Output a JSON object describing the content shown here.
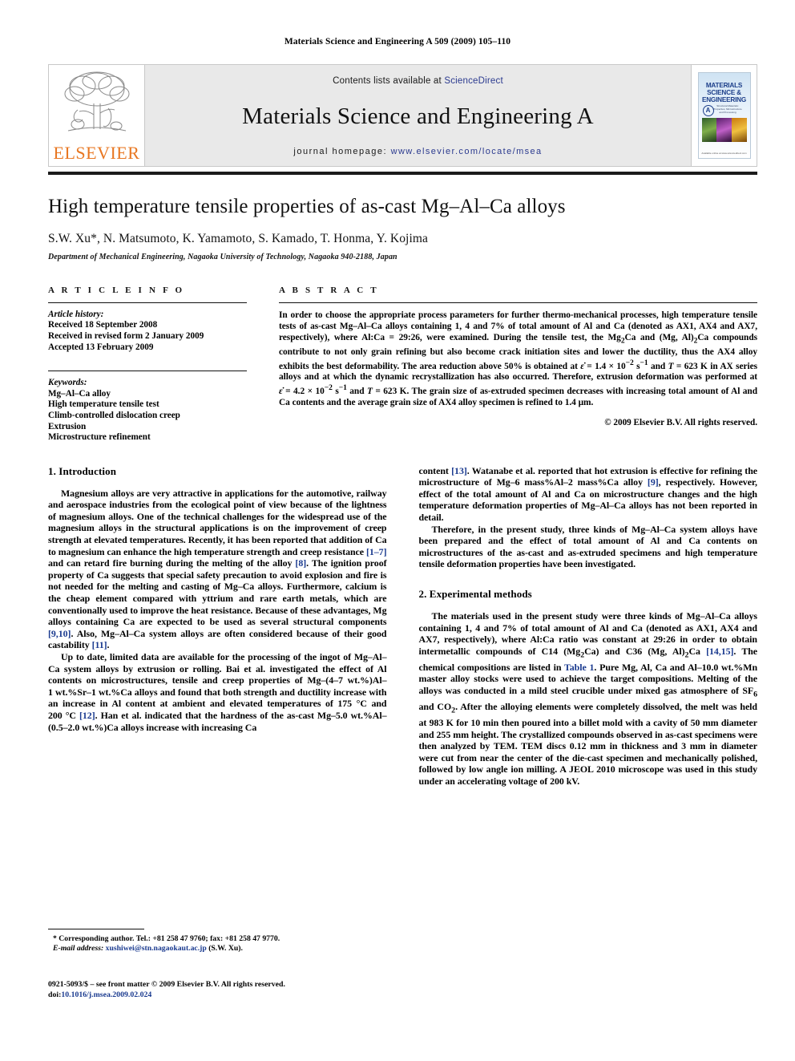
{
  "running_head": "Materials Science and Engineering A 509 (2009) 105–110",
  "masthead": {
    "publisher_name": "ELSEVIER",
    "contents_prefix": "Contents lists available at ",
    "contents_link": "ScienceDirect",
    "journal_title": "Materials Science and Engineering A",
    "homepage_prefix": "journal homepage: ",
    "homepage_url": "www.elsevier.com/locate/msea",
    "cover": {
      "line1": "MATERIALS",
      "line2": "SCIENCE &",
      "line3": "ENGINEERING",
      "badge": "A",
      "subtitle": "Structural Materials: Properties, Microstructure and Processing",
      "footer": "Available online at www.sciencedirect.com"
    },
    "link_color": "#2b3a8f",
    "brand_color": "#e87722"
  },
  "article": {
    "title": "High temperature tensile properties of as-cast Mg–Al–Ca alloys",
    "authors": "S.W. Xu*, N. Matsumoto, K. Yamamoto, S. Kamado, T. Honma, Y. Kojima",
    "affiliation": "Department of Mechanical Engineering, Nagaoka University of Technology, Nagaoka 940-2188, Japan"
  },
  "article_info": {
    "heading": "A R T I C L E   I N F O",
    "history_label": "Article history:",
    "history": [
      "Received 18 September 2008",
      "Received in revised form 2 January 2009",
      "Accepted 13 February 2009"
    ],
    "keywords_label": "Keywords:",
    "keywords": [
      "Mg–Al–Ca alloy",
      "High temperature tensile test",
      "Climb-controlled dislocation creep",
      "Extrusion",
      "Microstructure refinement"
    ]
  },
  "abstract": {
    "heading": "A B S T R A C T",
    "text": "In order to choose the appropriate process parameters for further thermo-mechanical processes, high temperature tensile tests of as-cast Mg–Al–Ca alloys containing 1, 4 and 7% of total amount of Al and Ca (denoted as AX1, AX4 and AX7, respectively), where Al:Ca = 29:26, were examined. During the tensile test, the Mg2Ca and (Mg, Al)2Ca compounds contribute to not only grain refining but also become crack initiation sites and lower the ductility, thus the AX4 alloy exhibits the best deformability. The area reduction above 50% is obtained at ε̇ = 1.4 × 10−2 s−1 and T = 623 K in AX series alloys and at which the dynamic recrystallization has also occurred. Therefore, extrusion deformation was performed at ε̇ = 4.2 × 10−2 s−1 and T = 623 K. The grain size of as-extruded specimen decreases with increasing total amount of Al and Ca contents and the average grain size of AX4 alloy specimen is refined to 1.4 μm.",
    "copyright": "© 2009 Elsevier B.V. All rights reserved."
  },
  "sections": {
    "introduction_heading": "1.  Introduction",
    "experimental_heading": "2.  Experimental methods",
    "intro_p1": "Magnesium alloys are very attractive in applications for the automotive, railway and aerospace industries from the ecological point of view because of the lightness of magnesium alloys. One of the technical challenges for the widespread use of the magnesium alloys in the structural applications is on the improvement of creep strength at elevated temperatures. Recently, it has been reported that addition of Ca to magnesium can enhance the high temperature strength and creep resistance [1–7] and can retard fire burning during the melting of the alloy [8]. The ignition proof property of Ca suggests that special safety precaution to avoid explosion and fire is not needed for the melting and casting of Mg–Ca alloys. Furthermore, calcium is the cheap element compared with yttrium and rare earth metals, which are conventionally used to improve the heat resistance. Because of these advantages, Mg alloys containing Ca are expected to be used as several structural components [9,10]. Also, Mg–Al–Ca system alloys are often considered because of their good castability [11].",
    "intro_p2": "Up to date, limited data are available for the processing of the ingot of Mg–Al–Ca system alloys by extrusion or rolling. Bai et al. investigated the effect of Al contents on microstructures, tensile and creep properties of Mg–(4–7 wt.%)Al–1 wt.%Sr–1 wt.%Ca alloys and found that both strength and ductility increase with an increase in Al content at ambient and elevated temperatures of 175 °C and 200 °C [12]. Han et al. indicated that the hardness of the as-cast Mg–5.0 wt.%Al–(0.5–2.0 wt.%)Ca alloys increase with increasing Ca content [13]. Watanabe et al. reported that hot extrusion is effective for refining the microstructure of Mg–6 mass%Al–2 mass%Ca alloy [9], respectively. However, effect of the total amount of Al and Ca on microstructure changes and the high temperature deformation properties of Mg–Al–Ca alloys has not been reported in detail.",
    "intro_p3": "Therefore, in the present study, three kinds of Mg–Al–Ca system alloys have been prepared and the effect of total amount of Al and Ca contents on microstructures of the as-cast and as-extruded specimens and high temperature tensile deformation properties have been investigated.",
    "exp_p1": "The materials used in the present study were three kinds of Mg–Al–Ca alloys containing 1, 4 and 7% of total amount of Al and Ca (denoted as AX1, AX4 and AX7, respectively), where Al:Ca ratio was constant at 29:26 in order to obtain intermetallic compounds of C14 (Mg2Ca) and C36 (Mg, Al)2Ca [14,15]. The chemical compositions are listed in Table 1. Pure Mg, Al, Ca and Al–10.0 wt.%Mn master alloy stocks were used to achieve the target compositions. Melting of the alloys was conducted in a mild steel crucible under mixed gas atmosphere of SF6 and CO2. After the alloying elements were completely dissolved, the melt was held at 983 K for 10 min then poured into a billet mold with a cavity of 50 mm diameter and 255 mm height. The crystallized compounds observed in as-cast specimens were then analyzed by TEM. TEM discs 0.12 mm in thickness and 3 mm in diameter were cut from near the center of the die-cast specimen and mechanically polished, followed by low angle ion milling. A JEOL 2010 microscope was used in this study under an accelerating voltage of 200 kV."
  },
  "footnotes": {
    "corresponding": "*  Corresponding author. Tel.: +81 258 47 9760; fax: +81 258 47 9770.",
    "email_label": "E-mail address:",
    "email": "xushiwei@stn.nagaokaut.ac.jp",
    "email_suffix": "(S.W. Xu).",
    "issn_line": "0921-5093/$ – see front matter © 2009 Elsevier B.V. All rights reserved.",
    "doi_label": "doi:",
    "doi_value": "10.1016/j.msea.2009.02.024"
  }
}
